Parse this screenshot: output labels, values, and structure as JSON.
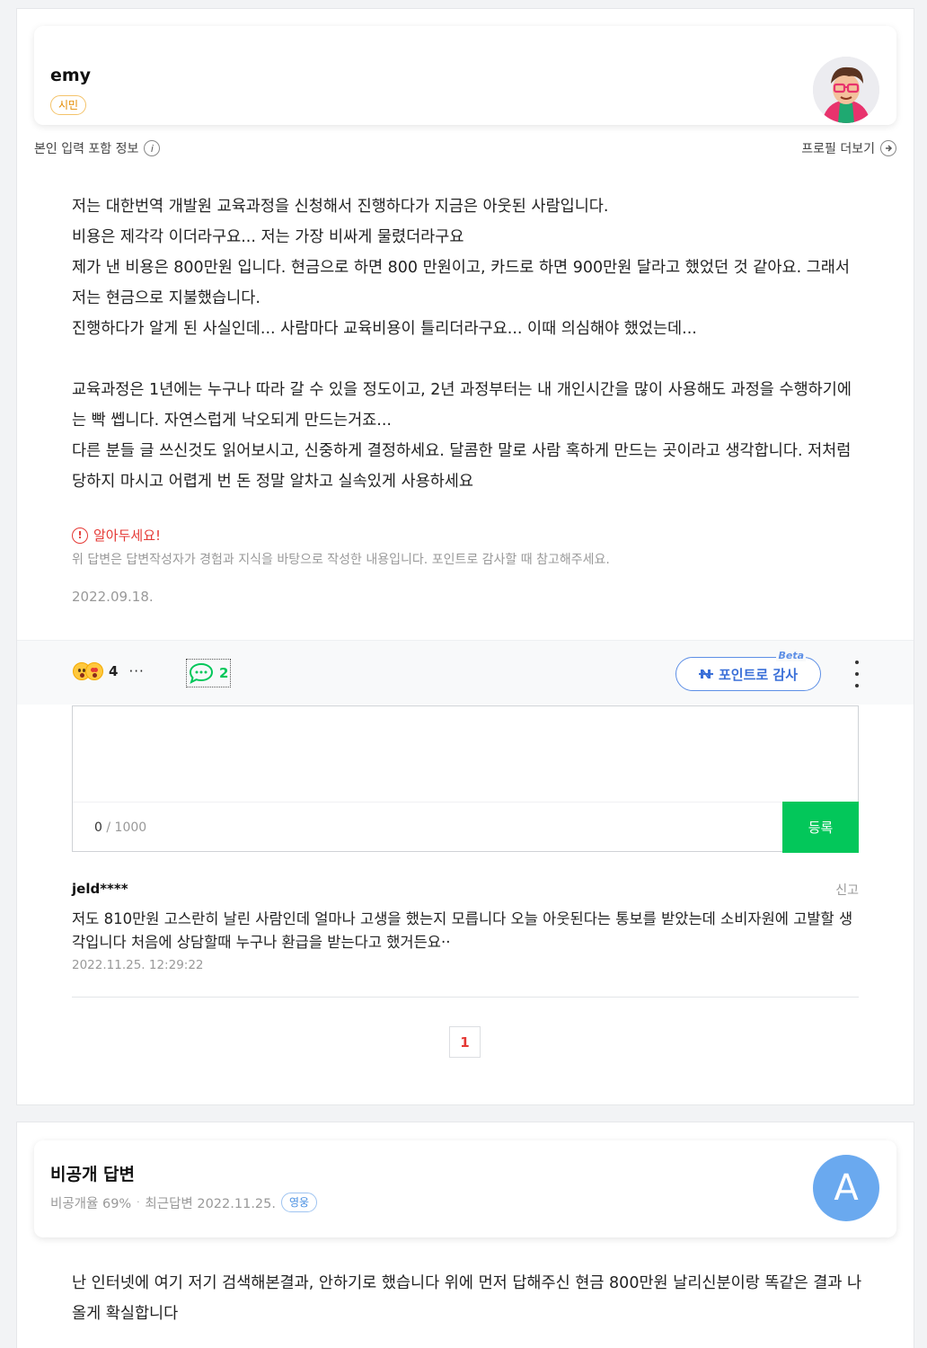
{
  "answer1": {
    "profile": {
      "name": "emy",
      "grade": "시민"
    },
    "info_label": "본인 입력 포함 정보",
    "info_icon": "info-icon",
    "profile_more_label": "프로필 더보기",
    "body_paragraphs": [
      "저는 대한번역 개발원 교육과정을 신청해서 진행하다가 지금은 아웃된 사람입니다.\n비용은 제각각 이더라구요... 저는 가장 비싸게 물렸더라구요\n제가 낸 비용은 800만원 입니다. 현금으로 하면 800 만원이고, 카드로 하면 900만원 달라고 했었던 것 같아요. 그래서 저는 현금으로 지불했습니다.\n진행하다가 알게 된 사실인데... 사람마다 교육비용이 틀리더라구요... 이때 의심해야 했었는데...",
      "교육과정은 1년에는 누구나 따라 갈 수 있을 정도이고, 2년 과정부터는 내 개인시간을 많이 사용해도 과정을 수행하기에는 빡 쎕니다. 자연스럽게 낙오되게 만드는거죠...\n다른 분들 글 쓰신것도 읽어보시고, 신중하게 결정하세요. 달콤한 말로 사람 혹하게 만드는 곳이라고 생각합니다. 저처럼 당하지 마시고 어렵게 번 돈 정말 알차고 실속있게 사용하세요"
    ],
    "notice_title": "알아두세요!",
    "notice_desc": "위 답변은 답변작성자가 경험과 지식을 바탕으로 작성한 내용입니다. 포인트로 감사할 때 참고해주세요.",
    "date": "2022.09.18.",
    "reactions": {
      "count": "4",
      "more": "···"
    },
    "comment_count": "2",
    "point_button": "포인트로 감사",
    "beta": "Beta",
    "editor": {
      "placeholder": "",
      "count_current": "0",
      "count_sep": " / ",
      "count_max": "1000",
      "submit": "등록"
    },
    "comments": [
      {
        "author": "jeld****",
        "report": "신고",
        "text": "저도 810만원 고스란히 날린 사람인데 얼마나 고생을 했는지 모릅니다 오늘 아웃된다는 통보를 받았는데 소비자원에 고발할 생각입니다 처음에 상담할때 누구나 환급을 받는다고 했거든요··",
        "date": "2022.11.25. 12:29:22"
      }
    ],
    "page": "1"
  },
  "answer2": {
    "name": "비공개 답변",
    "adoption_rate": "비공개율 69%",
    "recent": "최근답변 2022.11.25.",
    "tag": "영웅",
    "avatar_letter": "A",
    "body": "난 인터넷에 여기 저기 검색해본결과, 안하기로 했습니다 위에 먼저 답해주신 현금 800만원 날리신분이랑 똑같은 결과 나올게 확실합니다"
  },
  "colors": {
    "green": "#03c75a",
    "blue": "#5d8fe6",
    "red": "#e53935",
    "orange": "#e48b00"
  }
}
